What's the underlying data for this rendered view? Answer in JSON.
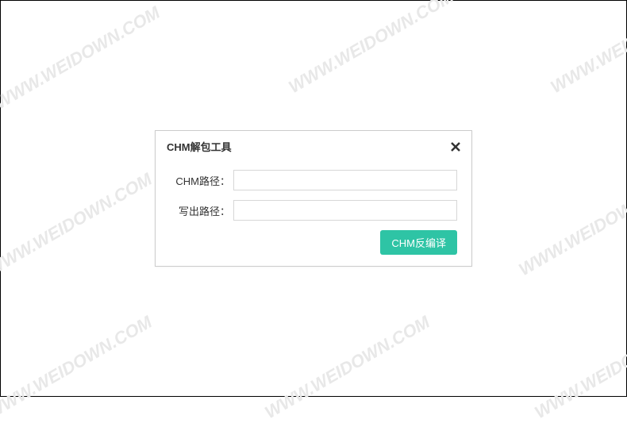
{
  "watermark": "WWW.WEIDOWN.COM",
  "dialog": {
    "title": "CHM解包工具",
    "fields": {
      "chm_path_label": "CHM路径：",
      "chm_path_value": "",
      "output_path_label": "写出路径：",
      "output_path_value": ""
    },
    "actions": {
      "decompile_label": "CHM反编译"
    }
  },
  "colors": {
    "accent": "#2ec4a5"
  }
}
